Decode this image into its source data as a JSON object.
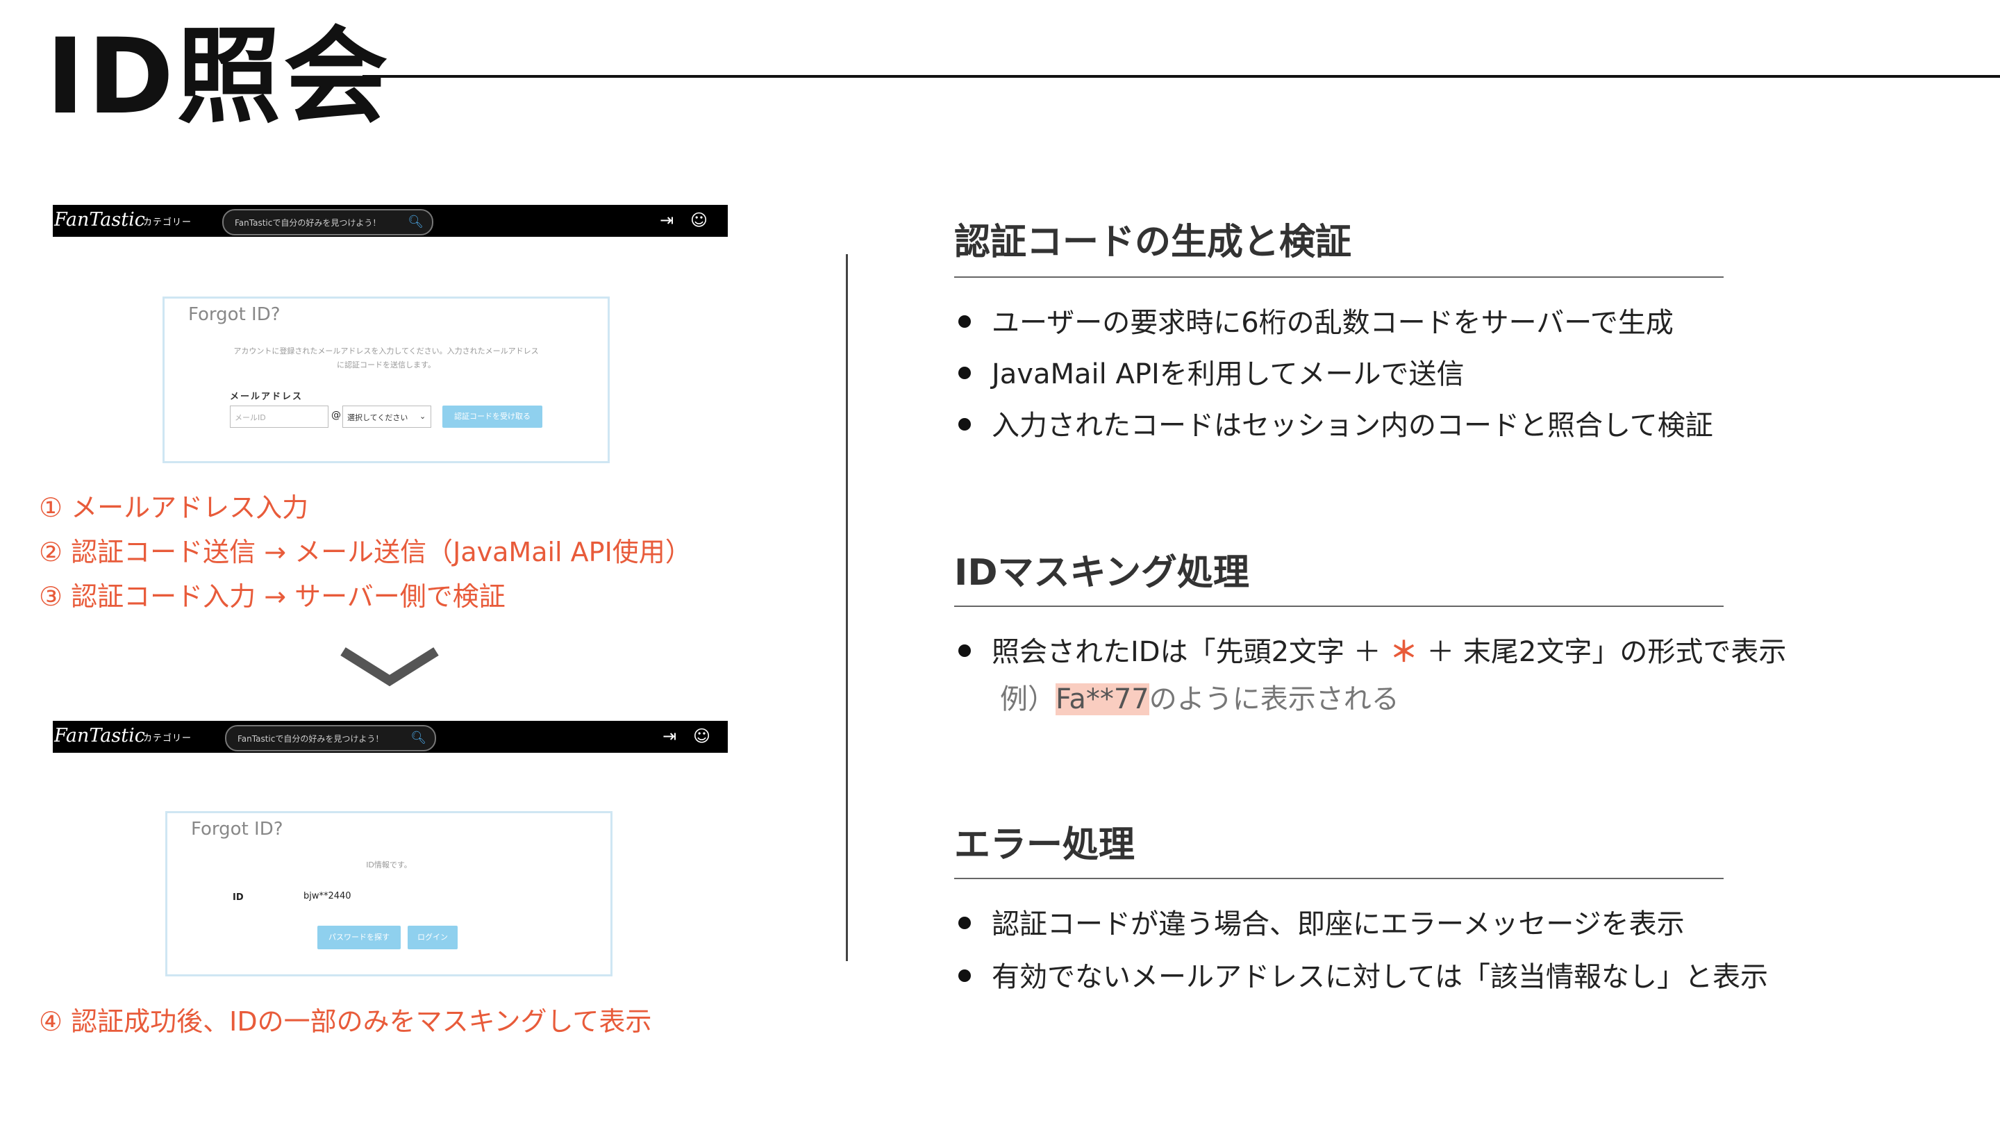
{
  "slide": {
    "title": "ID照会"
  },
  "mock_top": {
    "logo": "FanTastic",
    "category": "カテゴリー",
    "search_placeholder": "FanTasticで自分の好みを見つけよう！",
    "card_title": "Forgot ID?",
    "card_desc_1": "アカウントに登録されたメールアドレスを入力してください。入力されたメールアドレス",
    "card_desc_2": "に認証コードを送信します。",
    "email_label": "メールアドレス",
    "email_placeholder": "メールID",
    "at": "@",
    "domain_select": "選択してください",
    "submit": "認証コードを受け取る"
  },
  "mock_bottom": {
    "logo": "FanTastic",
    "category": "カテゴリー",
    "search_placeholder": "FanTasticで自分の好みを見つけよう！",
    "card_title": "Forgot ID?",
    "info": "ID情報です。",
    "id_label": "ID",
    "id_value": "bjw**2440",
    "find_password": "パスワードを探す",
    "login": "ログイン"
  },
  "steps": [
    "① メールアドレス入力",
    "② 認証コード送信 → メール送信（JavaMail API使用）",
    "③ 認証コード入力 → サーバー側で検証",
    "④ 認証成功後、IDの一部のみをマスキングして表示"
  ],
  "sections": [
    {
      "title": "認証コードの生成と検証",
      "bullets": [
        "ユーザーの要求時に6桁の乱数コードをサーバーで生成",
        "JavaMail APIを利用してメールで送信",
        "入力されたコードはセッション内のコードと照合して検証"
      ]
    },
    {
      "title": "IDマスキング処理",
      "bullet_pre": "照会されたIDは「先頭2文字 ＋ ",
      "bullet_star": "＊",
      "bullet_post": " ＋ 末尾2文字」の形式で表示",
      "example_pre": "例）",
      "example_hl": "Fa**77",
      "example_post": "のように表示される"
    },
    {
      "title": "エラー処理",
      "bullets": [
        "認証コードが違う場合、即座にエラーメッセージを表示",
        "有効でないメールアドレスに対しては「該当情報なし」と表示"
      ]
    }
  ]
}
